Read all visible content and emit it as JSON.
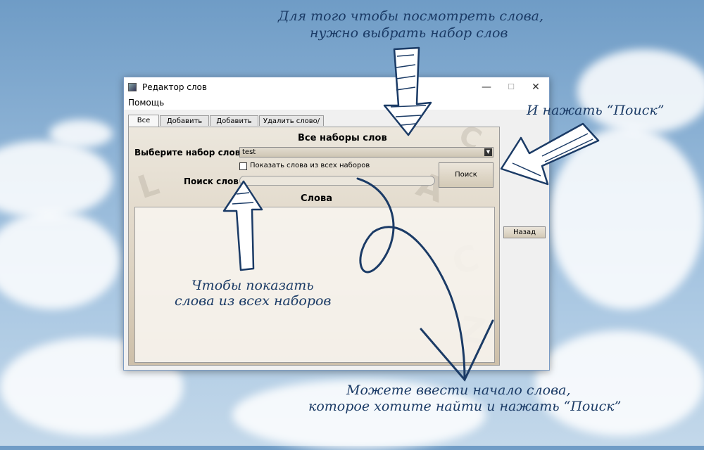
{
  "annotations": {
    "top_line1": "Для того чтобы посмотреть слова,",
    "top_line2": "нужно выбрать набор слов",
    "right": "И нажать “Поиск”",
    "middle_line1": "Чтобы показать",
    "middle_line2": "слова из всех наборов",
    "bottom_line1": "Можете ввести начало слова,",
    "bottom_line2": "которое хотите найти и нажать “Поиск”"
  },
  "window": {
    "title": "Редактор слов",
    "minimize_glyph": "—",
    "maximize_glyph": "☐",
    "close_glyph": "✕"
  },
  "menu": {
    "help": "Помощь"
  },
  "tabs": [
    {
      "label": "Все слова",
      "active": true
    },
    {
      "label": "Добавить слово",
      "active": false
    },
    {
      "label": "Добавить набор",
      "active": false
    },
    {
      "label": "Удалить слово/набор",
      "active": false
    }
  ],
  "form": {
    "heading": "Все наборы слов",
    "set_label": "Выберите набор слов",
    "set_value": "test",
    "show_all_label": "Показать слова из всех наборов",
    "show_all_checked": false,
    "search_label": "Поиск слов",
    "search_value": "",
    "search_button": "Поиск",
    "words_heading": "Слова",
    "back_button": "Назад"
  },
  "colors": {
    "annotation": "#1b3b66",
    "window_border": "#7a9bc4"
  }
}
